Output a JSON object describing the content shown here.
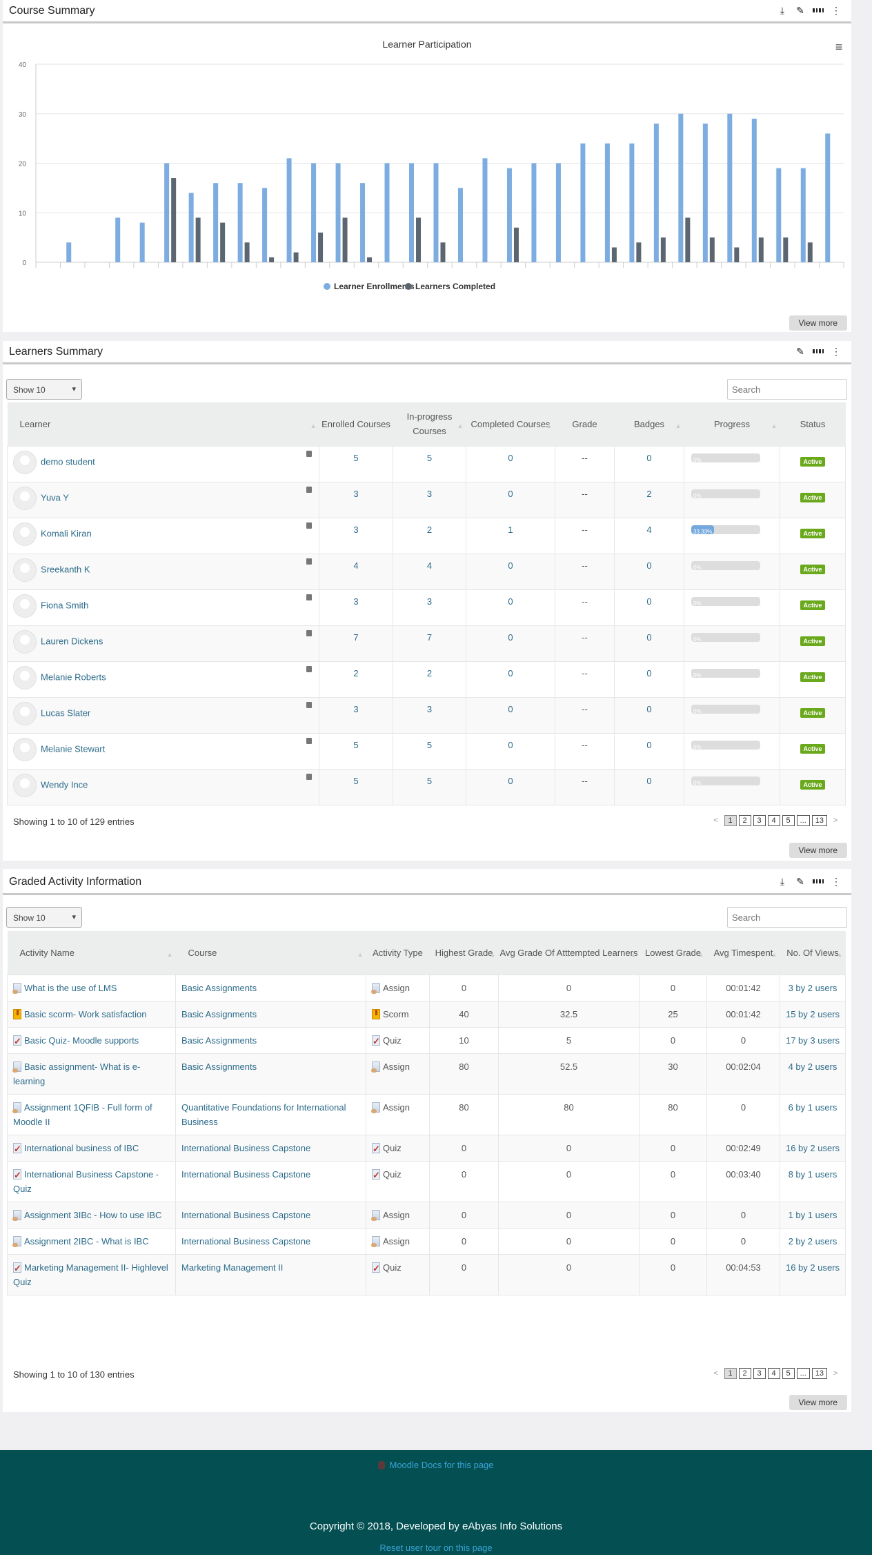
{
  "course_summary": {
    "title": "Course Summary",
    "icons": [
      "download-icon",
      "edit-icon",
      "grid-icon",
      "more-vertical-icon"
    ],
    "view_more": "View more",
    "chart_data": {
      "type": "bar",
      "title": "Learner Participation",
      "ylim": [
        0,
        40
      ],
      "yticks": [
        "0",
        "10",
        "20",
        "30",
        "40"
      ],
      "grid": true,
      "legend": "bottom",
      "categories": [
        "",
        "",
        "",
        "",
        "",
        "",
        "",
        "",
        "",
        "",
        "",
        "",
        "",
        "",
        "",
        "",
        "",
        "",
        "",
        "",
        "",
        "",
        "",
        "",
        "",
        "",
        "",
        "",
        "",
        "",
        "",
        "",
        ""
      ],
      "series": [
        {
          "name": "Learner Enrollments",
          "color": "#7cace0",
          "values": [
            0,
            4,
            0,
            9,
            8,
            20,
            14,
            16,
            16,
            15,
            21,
            20,
            20,
            16,
            20,
            20,
            20,
            15,
            21,
            19,
            20,
            20,
            24,
            24,
            24,
            28,
            30,
            28,
            30,
            29,
            19,
            19,
            26
          ]
        },
        {
          "name": "Learners Completed",
          "color": "#5c6670",
          "values": [
            0,
            0,
            0,
            0,
            0,
            17,
            9,
            8,
            4,
            1,
            2,
            6,
            9,
            1,
            0,
            9,
            4,
            0,
            0,
            7,
            0,
            0,
            0,
            3,
            4,
            5,
            9,
            5,
            3,
            5,
            5,
            4,
            0
          ]
        }
      ]
    }
  },
  "learners_summary": {
    "title": "Learners Summary",
    "show": "Show 10",
    "search_placeholder": "Search",
    "columns": [
      "Learner",
      "Enrolled Courses",
      "In-progress Courses",
      "Completed Courses",
      "Grade",
      "Badges",
      "Progress",
      "Status"
    ],
    "rows": [
      {
        "name": "demo student",
        "enrolled": "5",
        "inprogress": "5",
        "completed": "0",
        "grade": "--",
        "badges": "0",
        "progress": "0%",
        "progress_value": 0,
        "status": "Active"
      },
      {
        "name": "Yuva Y",
        "enrolled": "3",
        "inprogress": "3",
        "completed": "0",
        "grade": "--",
        "badges": "2",
        "progress": "0%",
        "progress_value": 0,
        "status": "Active"
      },
      {
        "name": "Komali Kiran",
        "enrolled": "3",
        "inprogress": "2",
        "completed": "1",
        "grade": "--",
        "badges": "4",
        "progress": "33.33%",
        "progress_value": 33.33,
        "status": "Active"
      },
      {
        "name": "Sreekanth K",
        "enrolled": "4",
        "inprogress": "4",
        "completed": "0",
        "grade": "--",
        "badges": "0",
        "progress": "0%",
        "progress_value": 0,
        "status": "Active"
      },
      {
        "name": "Fiona Smith",
        "enrolled": "3",
        "inprogress": "3",
        "completed": "0",
        "grade": "--",
        "badges": "0",
        "progress": "0%",
        "progress_value": 0,
        "status": "Active"
      },
      {
        "name": "Lauren Dickens",
        "enrolled": "7",
        "inprogress": "7",
        "completed": "0",
        "grade": "--",
        "badges": "0",
        "progress": "0%",
        "progress_value": 0,
        "status": "Active"
      },
      {
        "name": "Melanie Roberts",
        "enrolled": "2",
        "inprogress": "2",
        "completed": "0",
        "grade": "--",
        "badges": "0",
        "progress": "0%",
        "progress_value": 0,
        "status": "Active"
      },
      {
        "name": "Lucas Slater",
        "enrolled": "3",
        "inprogress": "3",
        "completed": "0",
        "grade": "--",
        "badges": "0",
        "progress": "0%",
        "progress_value": 0,
        "status": "Active"
      },
      {
        "name": "Melanie Stewart",
        "enrolled": "5",
        "inprogress": "5",
        "completed": "0",
        "grade": "--",
        "badges": "0",
        "progress": "0%",
        "progress_value": 0,
        "status": "Active"
      },
      {
        "name": "Wendy Ince",
        "enrolled": "5",
        "inprogress": "5",
        "completed": "0",
        "grade": "--",
        "badges": "0",
        "progress": "0%",
        "progress_value": 0,
        "status": "Active"
      }
    ],
    "info": "Showing 1 to 10 of 129 entries",
    "pages": [
      "<",
      "1",
      "2",
      "3",
      "4",
      "5",
      "...",
      "13",
      ">"
    ],
    "view_more": "View more"
  },
  "graded_activity": {
    "title": "Graded Activity Information",
    "show": "Show 10",
    "search_placeholder": "Search",
    "columns": [
      "Activity Name",
      "Course",
      "Activity Type",
      "Highest Grade",
      "Avg Grade Of Atttempted Learners",
      "Lowest Grade",
      "Avg Timespent",
      "No. Of Views"
    ],
    "rows": [
      {
        "icon": "assign",
        "activity": "What is the use of LMS",
        "course": "Basic Assignments",
        "type": "Assign",
        "highest": "0",
        "avg": "0",
        "lowest": "0",
        "time": "00:01:42",
        "views": "3 by 2 users"
      },
      {
        "icon": "scorm",
        "activity": "Basic scorm- Work satisfaction",
        "course": "Basic Assignments",
        "type": "Scorm",
        "highest": "40",
        "avg": "32.5",
        "lowest": "25",
        "time": "00:01:42",
        "views": "15 by 2 users"
      },
      {
        "icon": "quiz",
        "activity": "Basic Quiz- Moodle supports",
        "course": "Basic Assignments",
        "type": "Quiz",
        "highest": "10",
        "avg": "5",
        "lowest": "0",
        "time": "0",
        "views": "17 by 3 users"
      },
      {
        "icon": "assign",
        "activity": "Basic assignment- What is e-learning",
        "course": "Basic Assignments",
        "type": "Assign",
        "highest": "80",
        "avg": "52.5",
        "lowest": "30",
        "time": "00:02:04",
        "views": "4 by 2 users"
      },
      {
        "icon": "assign",
        "activity": "Assignment 1QFIB - Full form of Moodle II",
        "course": "Quantitative Foundations for International Business",
        "type": "Assign",
        "highest": "80",
        "avg": "80",
        "lowest": "80",
        "time": "0",
        "views": "6 by 1 users"
      },
      {
        "icon": "quiz",
        "activity": "International business of IBC",
        "course": "International Business Capstone",
        "type": "Quiz",
        "highest": "0",
        "avg": "0",
        "lowest": "0",
        "time": "00:02:49",
        "views": "16 by 2 users"
      },
      {
        "icon": "quiz",
        "activity": "International Business Capstone -Quiz",
        "course": "International Business Capstone",
        "type": "Quiz",
        "highest": "0",
        "avg": "0",
        "lowest": "0",
        "time": "00:03:40",
        "views": "8 by 1 users"
      },
      {
        "icon": "assign",
        "activity": "Assignment 3IBc - How to use IBC",
        "course": "International Business Capstone",
        "type": "Assign",
        "highest": "0",
        "avg": "0",
        "lowest": "0",
        "time": "0",
        "views": "1 by 1 users"
      },
      {
        "icon": "assign",
        "activity": "Assignment 2IBC - What is IBC",
        "course": "International Business Capstone",
        "type": "Assign",
        "highest": "0",
        "avg": "0",
        "lowest": "0",
        "time": "0",
        "views": "2 by 2 users"
      },
      {
        "icon": "quiz",
        "activity": "Marketing Management II- Highlevel Quiz",
        "course": "Marketing Management II",
        "type": "Quiz",
        "highest": "0",
        "avg": "0",
        "lowest": "0",
        "time": "00:04:53",
        "views": "16 by 2 users"
      }
    ],
    "info": "Showing 1 to 10 of 130 entries",
    "pages": [
      "<",
      "1",
      "2",
      "3",
      "4",
      "5",
      "...",
      "13",
      ">"
    ],
    "view_more": "View more"
  },
  "footer": {
    "docs_link": "Moodle Docs for this page",
    "copyright": "Copyright © 2018, Developed by eAbyas Info Solutions",
    "reset_tour": "Reset user tour on this page",
    "background": "#034f52"
  }
}
